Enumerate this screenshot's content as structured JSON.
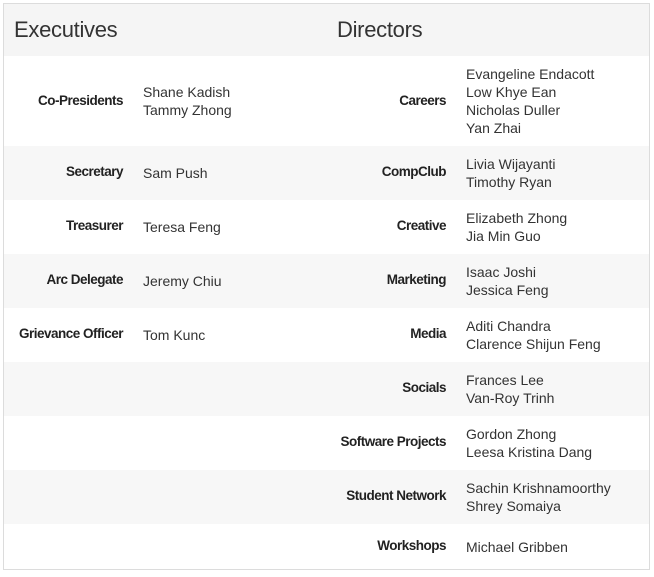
{
  "headers": {
    "executives": "Executives",
    "directors": "Directors"
  },
  "executives": [
    {
      "role": "Co-Presidents",
      "names": [
        "Shane Kadish",
        "Tammy Zhong"
      ]
    },
    {
      "role": "Secretary",
      "names": [
        "Sam Push"
      ]
    },
    {
      "role": "Treasurer",
      "names": [
        "Teresa Feng"
      ]
    },
    {
      "role": "Arc Delegate",
      "names": [
        "Jeremy Chiu"
      ]
    },
    {
      "role": "Grievance Officer",
      "names": [
        "Tom Kunc"
      ]
    }
  ],
  "directors": [
    {
      "role": "Careers",
      "names": [
        "Evangeline Endacott",
        "Low Khye Ean",
        "Nicholas Duller",
        "Yan Zhai"
      ]
    },
    {
      "role": "CompClub",
      "names": [
        "Livia Wijayanti",
        "Timothy Ryan"
      ]
    },
    {
      "role": "Creative",
      "names": [
        "Elizabeth Zhong",
        "Jia Min Guo"
      ]
    },
    {
      "role": "Marketing",
      "names": [
        "Isaac Joshi",
        "Jessica Feng"
      ]
    },
    {
      "role": "Media",
      "names": [
        "Aditi Chandra",
        "Clarence Shijun Feng"
      ]
    },
    {
      "role": "Socials",
      "names": [
        "Frances Lee",
        "Van-Roy Trinh"
      ]
    },
    {
      "role": "Software Projects",
      "names": [
        "Gordon Zhong",
        "Leesa Kristina Dang"
      ]
    },
    {
      "role": "Student Network",
      "names": [
        "Sachin Krishnamoorthy",
        "Shrey Somaiya"
      ]
    },
    {
      "role": "Workshops",
      "names": [
        "Michael Gribben"
      ]
    }
  ]
}
